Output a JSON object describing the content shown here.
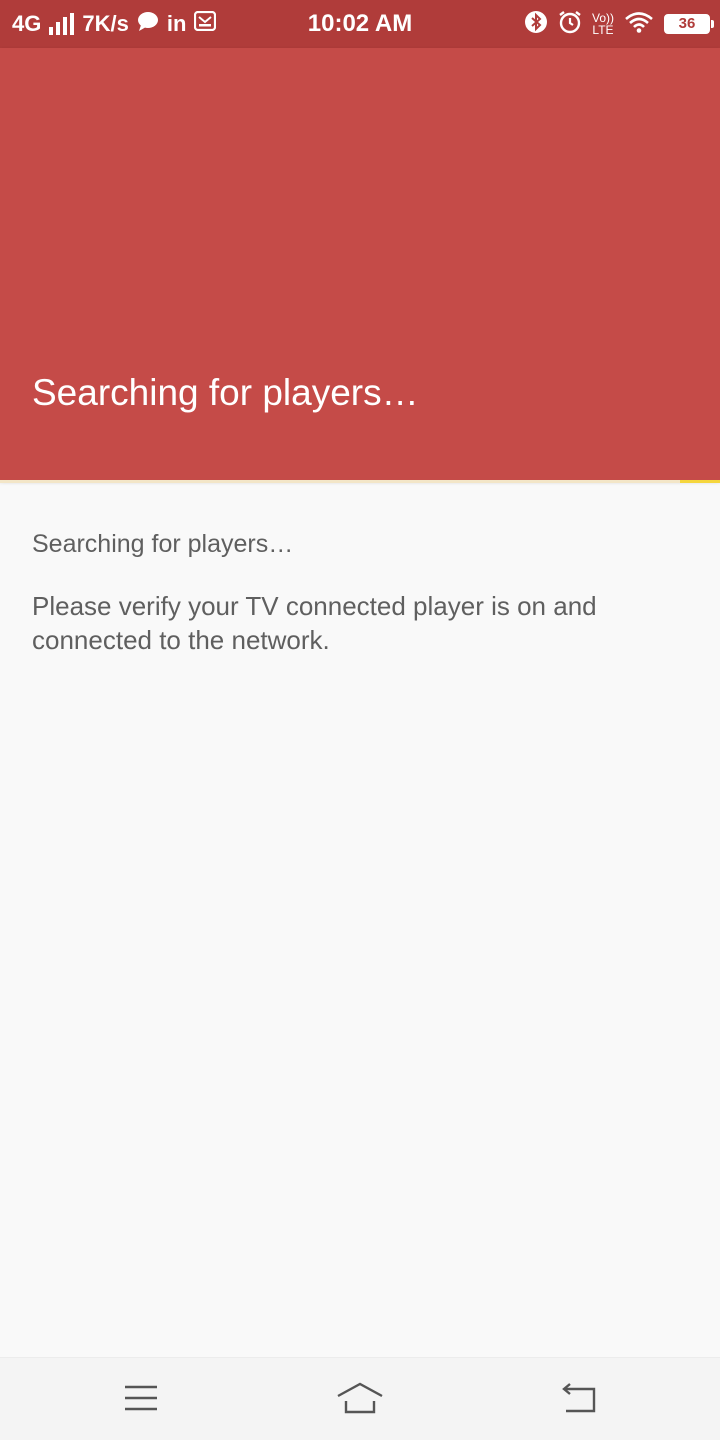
{
  "status_bar": {
    "network": "4G",
    "speed": "7K/s",
    "linkedin": "in",
    "time": "10:02 AM",
    "volte_top": "Vo))",
    "volte_bottom": "LTE",
    "battery": "36"
  },
  "header": {
    "title": "Searching for players…",
    "color": "#c54b48"
  },
  "content": {
    "status": "Searching for players…",
    "help": "Please verify your TV connected player is on and connected to the network."
  },
  "nav_bar": {
    "icons": [
      "menu-icon",
      "home-icon",
      "back-icon"
    ]
  },
  "colors": {
    "status_bar": "#b03c3a",
    "accent": "#f5d63d",
    "text": "#5f5f5f"
  }
}
